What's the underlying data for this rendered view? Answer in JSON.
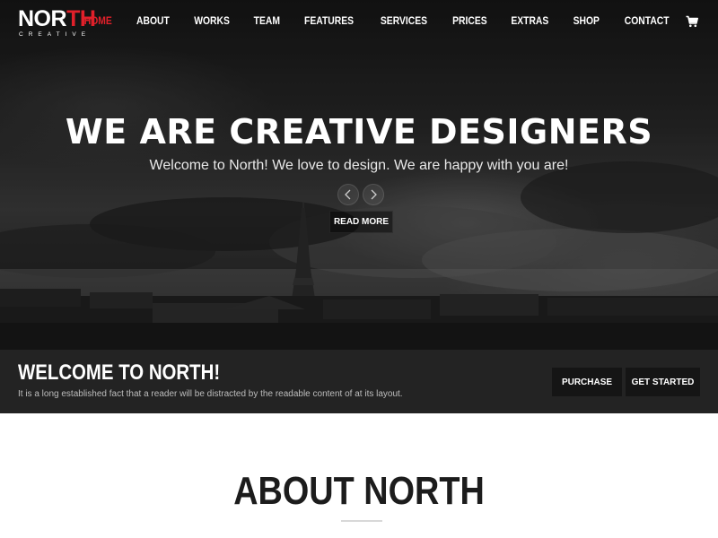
{
  "brand": {
    "logo_main_a": "NOR",
    "logo_main_b": "TH",
    "logo_sub": "CREATIVE",
    "accent_color": "#e0202a"
  },
  "nav": {
    "items": [
      {
        "label": "HOME",
        "active": true
      },
      {
        "label": "ABOUT"
      },
      {
        "label": "WORKS"
      },
      {
        "label": "TEAM"
      },
      {
        "label": "FEATURES"
      },
      {
        "label": "SERVICES"
      },
      {
        "label": "PRICES"
      },
      {
        "label": "EXTRAS"
      },
      {
        "label": "SHOP"
      },
      {
        "label": "CONTACT"
      }
    ],
    "cart_icon": "shopping-cart-icon"
  },
  "hero": {
    "title": "WE ARE CREATIVE DESIGNERS",
    "subtitle": "Welcome to North! We love to design. We are happy with you are!",
    "prev_icon": "chevron-left-icon",
    "next_icon": "chevron-right-icon",
    "cta_label": "READ MORE"
  },
  "welcome": {
    "title": "WELCOME TO NORTH!",
    "text": "It is a long established fact that a reader will be distracted by the readable content of at its layout.",
    "purchase_label": "PURCHASE",
    "get_started_label": "GET STARTED"
  },
  "about": {
    "title": "ABOUT NORTH",
    "text": ""
  }
}
